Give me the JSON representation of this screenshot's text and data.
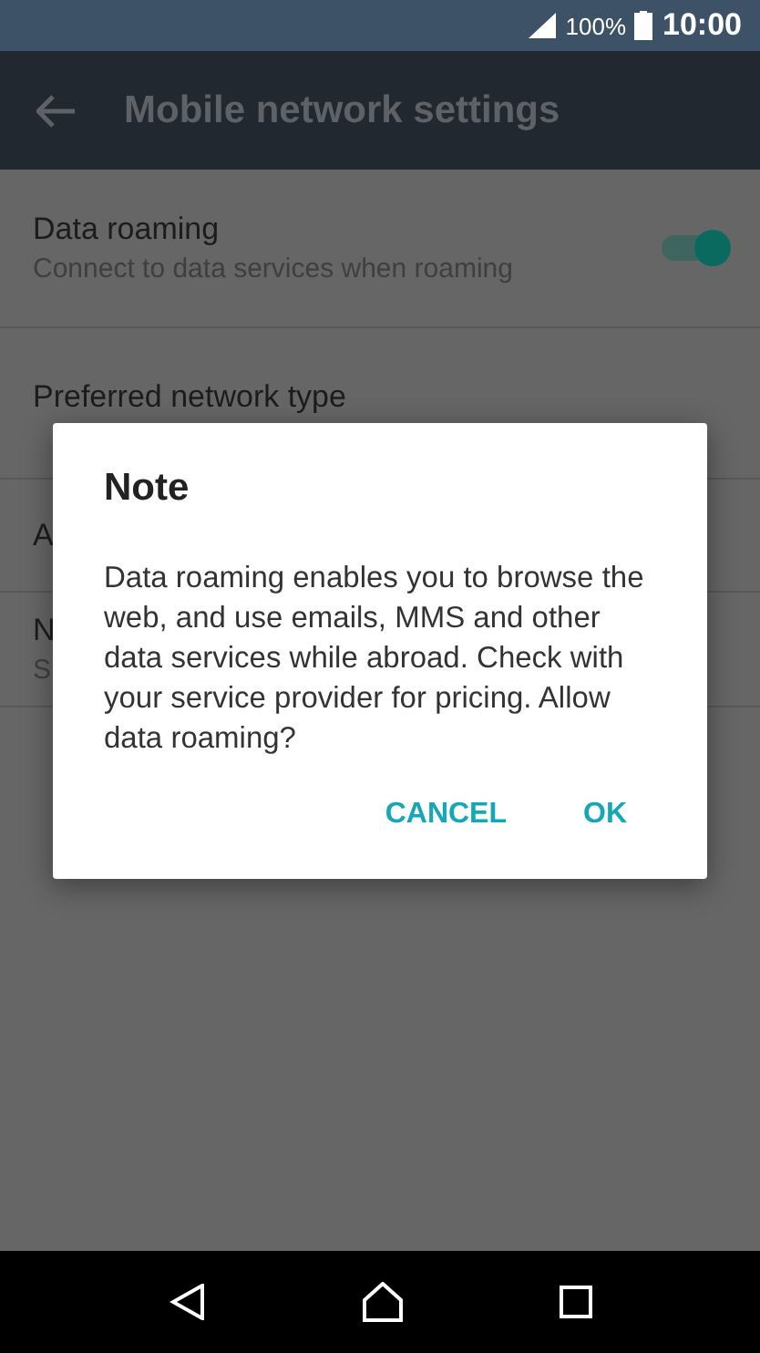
{
  "status_bar": {
    "battery": "100%",
    "time": "10:00"
  },
  "app_bar": {
    "title": "Mobile network settings"
  },
  "settings": [
    {
      "kind": "toggle",
      "title": "Data roaming",
      "subtitle": "Connect to data services when roaming",
      "on": true
    },
    {
      "kind": "plain",
      "title": "Preferred network type"
    },
    {
      "kind": "plain",
      "title": "A"
    },
    {
      "kind": "plain",
      "title": "N",
      "subtitle": "S"
    }
  ],
  "dialog": {
    "title": "Note",
    "message": "Data roaming enables you to browse the web, and use emails, MMS and other data services while abroad. Check with your service provider for pricing. Allow data roaming?",
    "buttons": [
      "CANCEL",
      "OK"
    ]
  }
}
